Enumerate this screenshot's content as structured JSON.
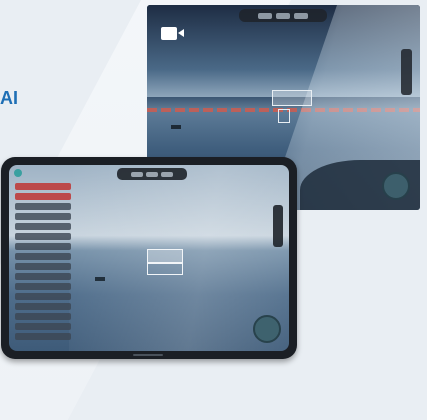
{
  "headline": {
    "text": "AI"
  },
  "colors": {
    "accent": "#1f6fb5",
    "alert": "#be3c3c",
    "horizon_marker": "#d45a4a"
  },
  "camera_panel": {
    "icons": [
      "video-camera-icon"
    ],
    "corner_text": "",
    "top_toolbar_segments": 3
  },
  "tablet": {
    "status_text": "",
    "sidebar_items": [
      {
        "state": "alert"
      },
      {
        "state": "alert"
      },
      {
        "state": "normal"
      },
      {
        "state": "normal"
      },
      {
        "state": "normal"
      },
      {
        "state": "normal"
      },
      {
        "state": "normal"
      },
      {
        "state": "normal"
      },
      {
        "state": "normal"
      },
      {
        "state": "normal"
      },
      {
        "state": "normal"
      },
      {
        "state": "normal"
      },
      {
        "state": "normal"
      },
      {
        "state": "normal"
      },
      {
        "state": "normal"
      },
      {
        "state": "normal"
      }
    ]
  }
}
